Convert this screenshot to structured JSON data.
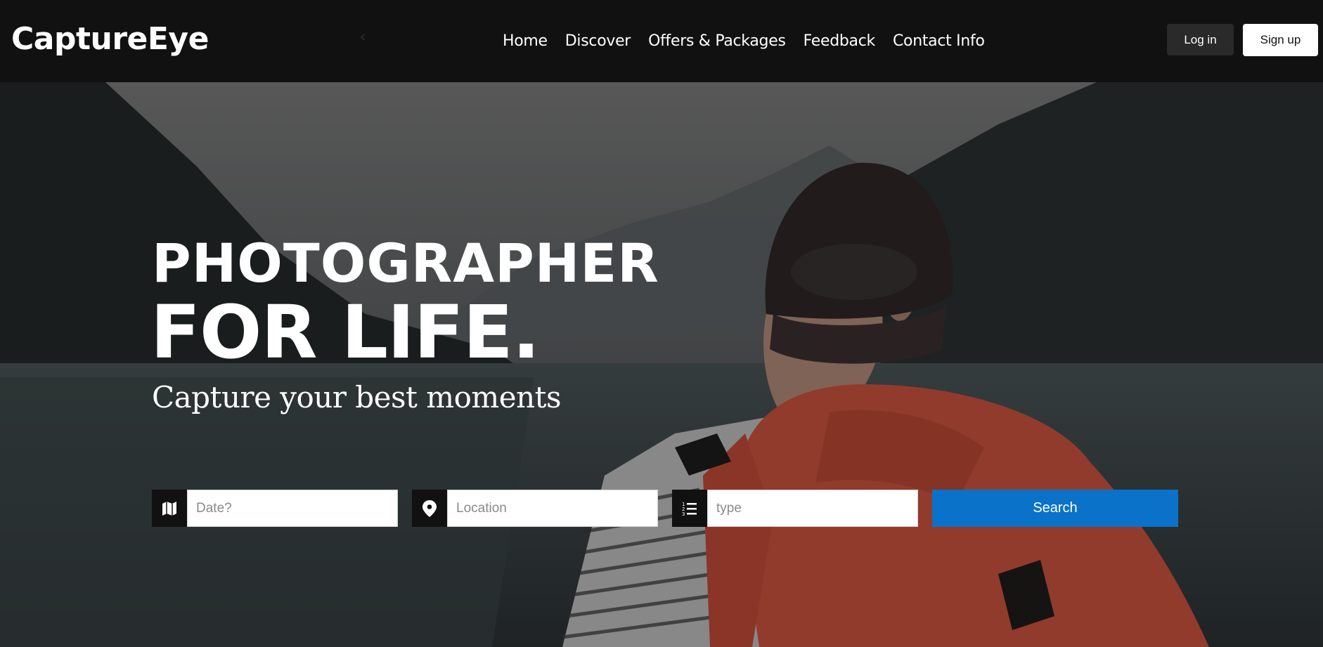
{
  "brand": {
    "logo_text": "CaptureEye"
  },
  "nav": {
    "items": [
      {
        "label": "Home"
      },
      {
        "label": "Discover"
      },
      {
        "label": "Offers & Packages"
      },
      {
        "label": "Feedback"
      },
      {
        "label": "Contact Info"
      }
    ],
    "login_label": "Log in",
    "signup_label": "Sign up"
  },
  "hero": {
    "title_line_1": "PHOTOGRAPHER",
    "title_line_2": "FOR LIFE.",
    "subtitle": "Capture your best moments"
  },
  "search": {
    "date_placeholder": "Date?",
    "location_placeholder": "Location",
    "type_placeholder": "type",
    "button_label": "Search",
    "icons": [
      "map-icon",
      "location-pin-icon",
      "list-icon"
    ]
  },
  "colors": {
    "navbar_bg": "#111111",
    "accent": "#0a72c8",
    "backpack": "#c9533f"
  }
}
